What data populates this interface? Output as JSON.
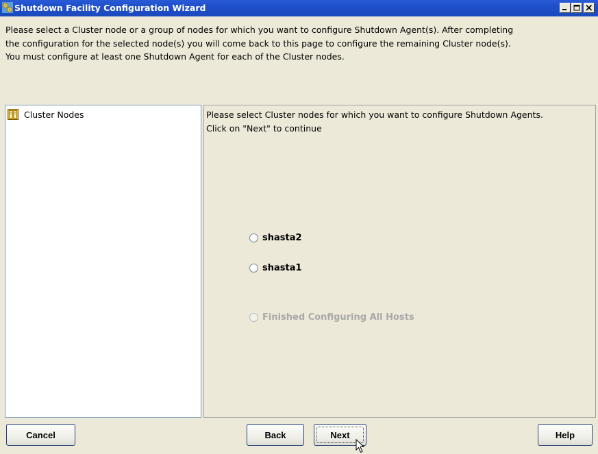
{
  "window": {
    "title": "Shutdown Facility Configuration Wizard",
    "controls": [
      "minimize",
      "maximize",
      "close"
    ]
  },
  "instructions": {
    "lines": [
      "Please select a Cluster node or a group of nodes for which you want to configure Shutdown Agent(s). After completing",
      "the configuration for the selected node(s) you will come back to this page to configure the remaining Cluster node(s).",
      "You must configure at least one Shutdown Agent for each of the Cluster nodes."
    ]
  },
  "tree": {
    "root_label": "Cluster Nodes",
    "root_icon": "cluster-nodes-icon"
  },
  "main": {
    "instruction_lines": [
      "Please select Cluster nodes for which you want to configure Shutdown Agents.",
      "Click on \"Next\" to continue"
    ],
    "options": [
      {
        "label": "shasta2",
        "selected": false,
        "enabled": true
      },
      {
        "label": "shasta1",
        "selected": false,
        "enabled": true
      },
      {
        "label": "Finished Configuring All Hosts",
        "selected": false,
        "enabled": false
      }
    ]
  },
  "buttons": {
    "cancel": "Cancel",
    "back": "Back",
    "next": "Next",
    "help": "Help"
  },
  "colors": {
    "titlebar": "#1E4FC9",
    "background": "#ECE9D8",
    "disabled_text": "#A8A8A8"
  }
}
